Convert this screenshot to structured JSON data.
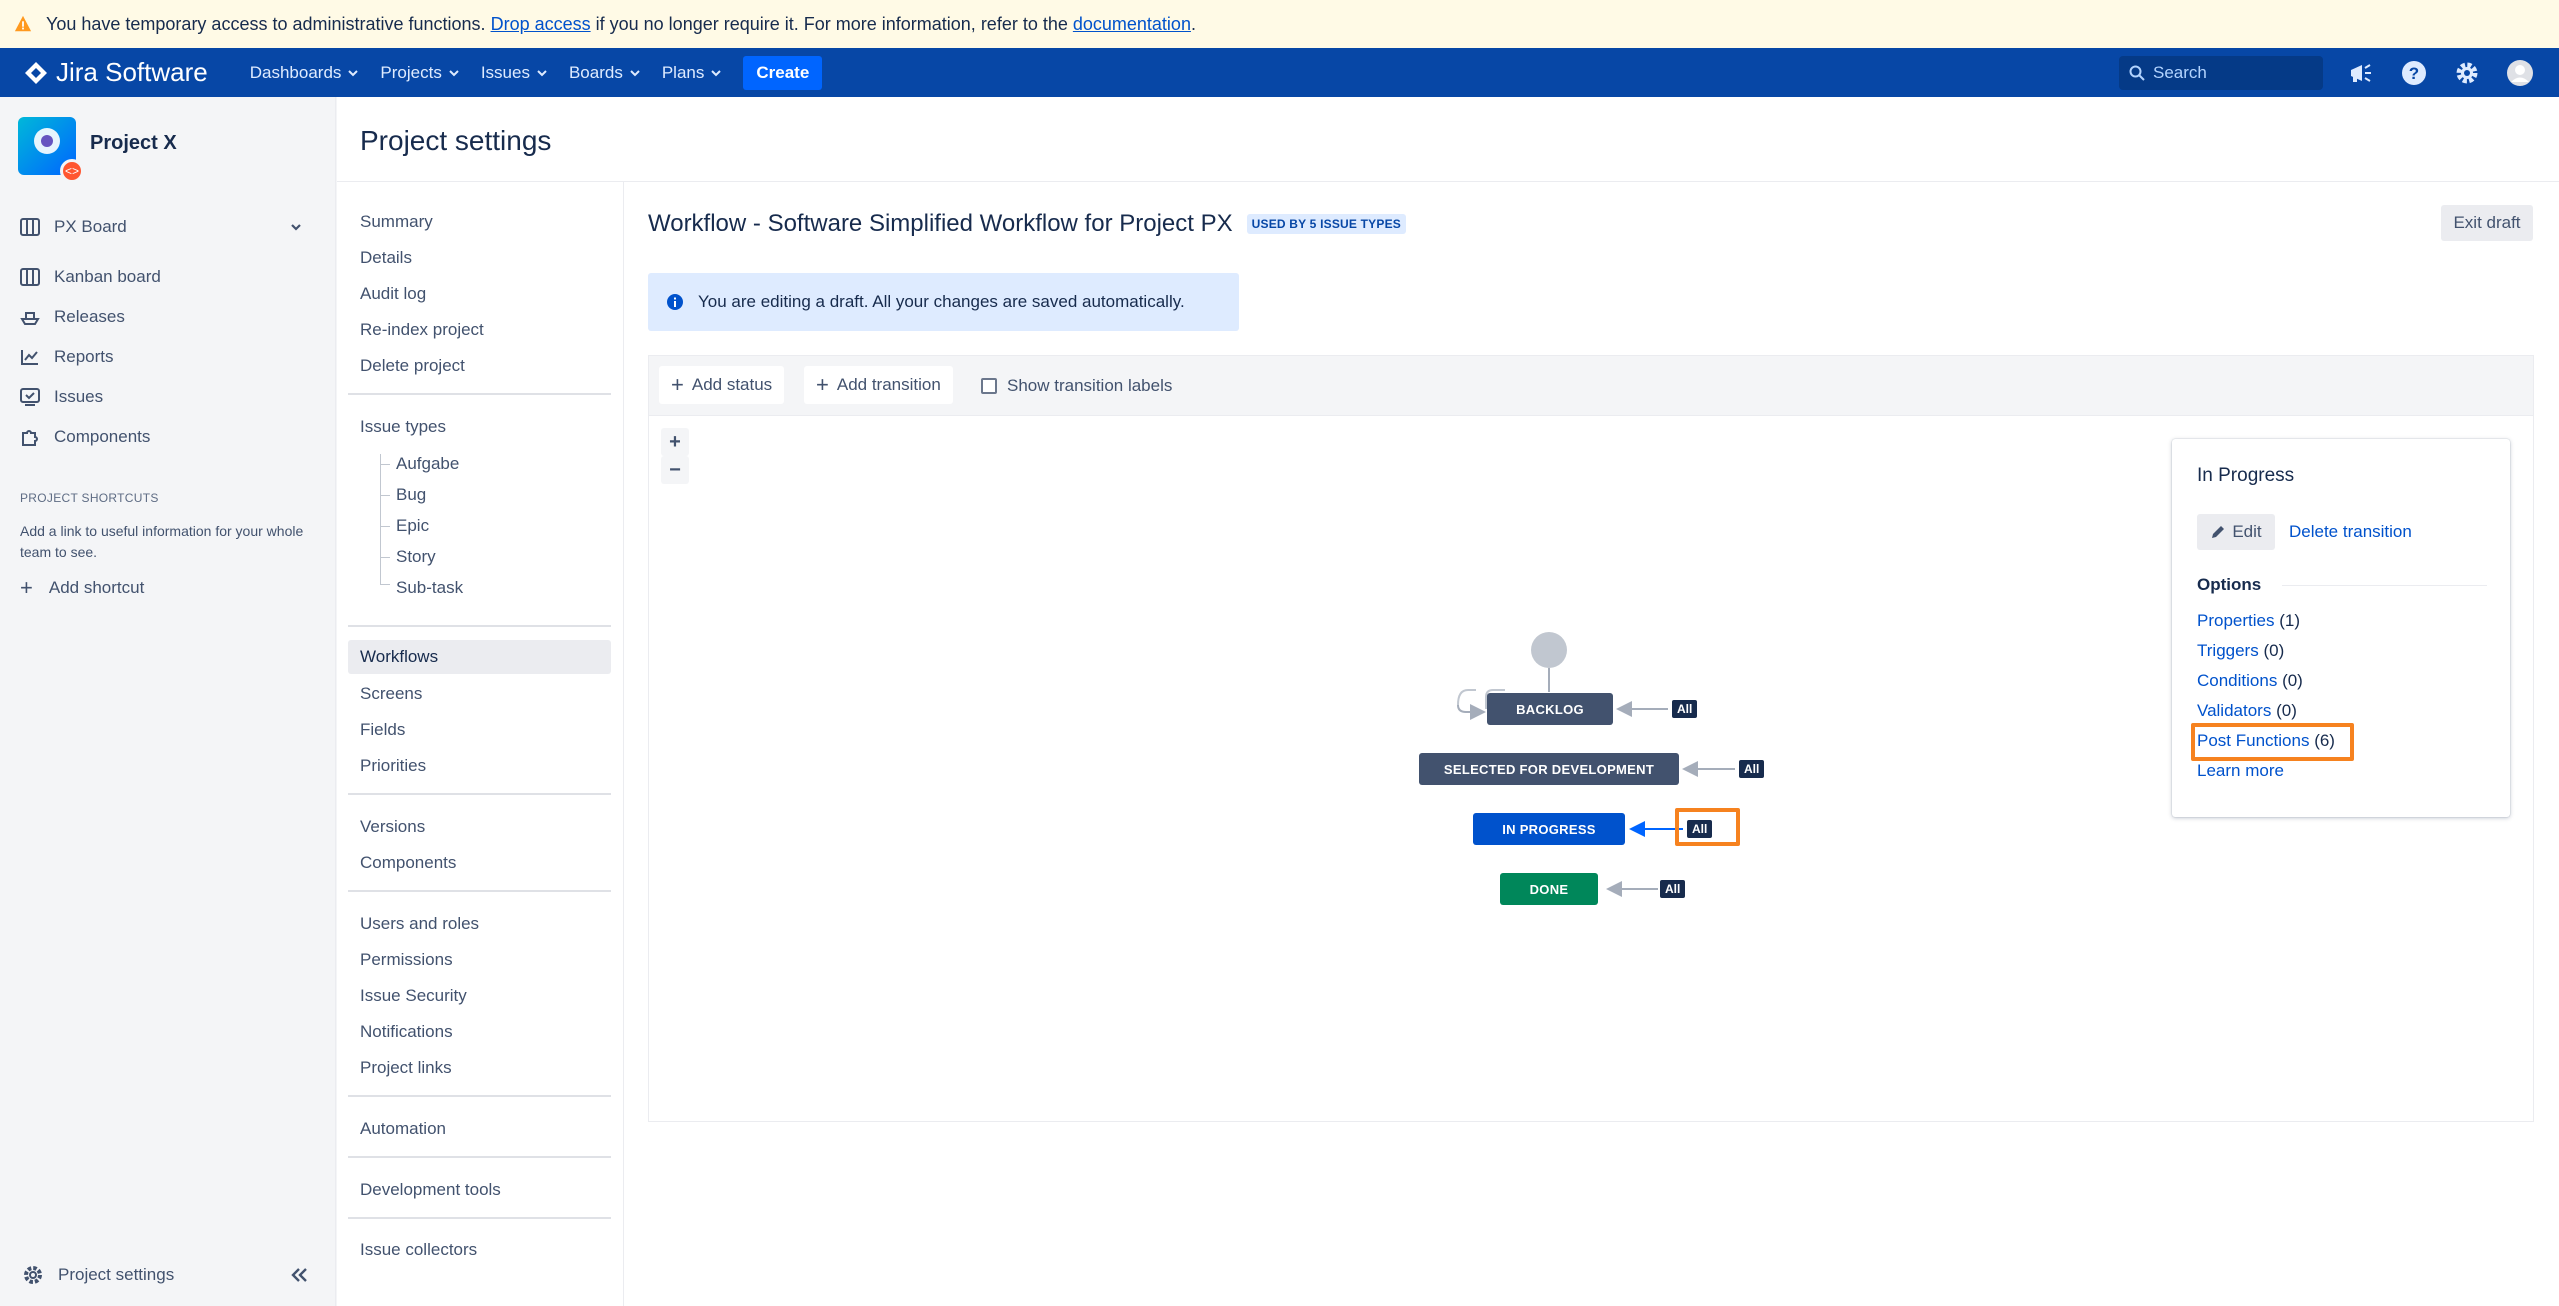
{
  "banner": {
    "text_before": "You have temporary access to administrative functions.",
    "drop_link": "Drop access",
    "text_mid": "if you no longer require it. For more information, refer to the",
    "doc_link": "documentation",
    "text_end": "."
  },
  "topnav": {
    "product": "Jira Software",
    "menus": [
      "Dashboards",
      "Projects",
      "Issues",
      "Boards",
      "Plans"
    ],
    "create": "Create",
    "search_placeholder": "Search"
  },
  "sidebar": {
    "project_name": "Project X",
    "board": "PX Board",
    "items": [
      "Kanban board",
      "Releases",
      "Reports",
      "Issues",
      "Components"
    ],
    "shortcuts_heading": "PROJECT SHORTCUTS",
    "shortcuts_desc": "Add a link to useful information for your whole team to see.",
    "add_shortcut": "Add shortcut",
    "footer": "Project settings"
  },
  "page": {
    "title": "Project settings"
  },
  "settings_nav": {
    "group1": [
      "Summary",
      "Details",
      "Audit log",
      "Re-index project",
      "Delete project"
    ],
    "issue_types": "Issue types",
    "issue_type_list": [
      "Aufgabe",
      "Bug",
      "Epic",
      "Story",
      "Sub-task"
    ],
    "group3": [
      "Workflows",
      "Screens",
      "Fields",
      "Priorities"
    ],
    "group4": [
      "Versions",
      "Components"
    ],
    "group5": [
      "Users and roles",
      "Permissions",
      "Issue Security",
      "Notifications",
      "Project links"
    ],
    "automation": "Automation",
    "devtools": "Development tools",
    "collectors": "Issue collectors"
  },
  "workflow": {
    "title": "Workflow - Software Simplified Workflow for Project PX",
    "lozenge": "USED BY 5 ISSUE TYPES",
    "exit_draft": "Exit draft",
    "draft_msg": "You are editing a draft. All your changes are saved automatically.",
    "add_status": "Add status",
    "add_transition": "Add transition",
    "show_labels": "Show transition labels",
    "zoom_in": "+",
    "zoom_out": "−",
    "statuses": {
      "backlog": "BACKLOG",
      "selected": "SELECTED FOR DEVELOPMENT",
      "in_progress": "IN PROGRESS",
      "done": "DONE"
    },
    "all_label": "All",
    "colors": {
      "todo": "#42526e",
      "inprogress": "#0052cc",
      "done": "#00875a"
    }
  },
  "panel": {
    "title": "In Progress",
    "edit": "Edit",
    "delete": "Delete transition",
    "options_heading": "Options",
    "options": [
      {
        "label": "Properties",
        "count": "(1)"
      },
      {
        "label": "Triggers",
        "count": "(0)"
      },
      {
        "label": "Conditions",
        "count": "(0)"
      },
      {
        "label": "Validators",
        "count": "(0)"
      },
      {
        "label": "Post Functions",
        "count": "(6)"
      }
    ],
    "learn_more": "Learn more"
  }
}
